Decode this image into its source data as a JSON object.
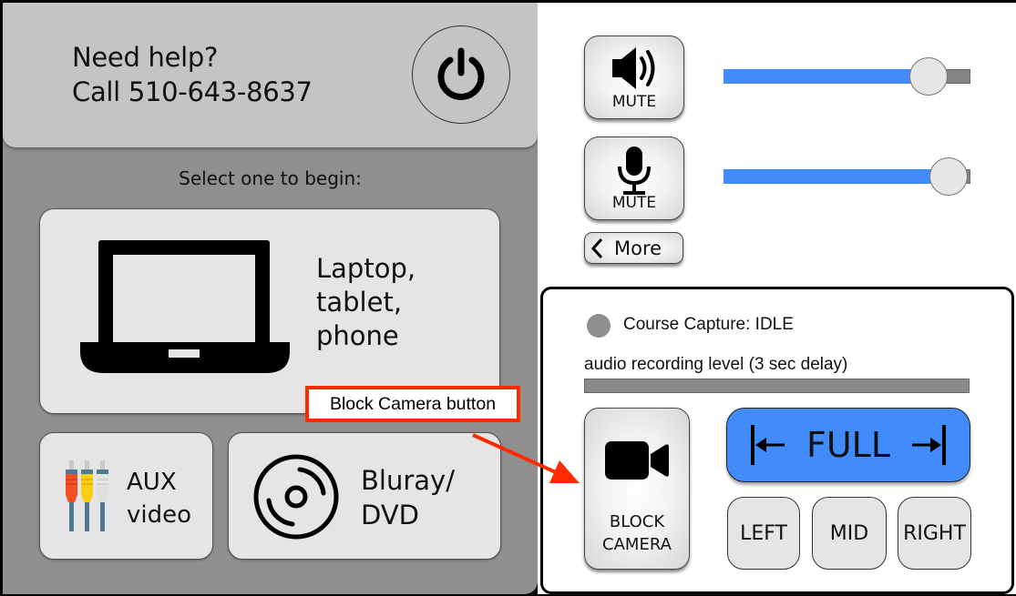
{
  "help": {
    "line1": "Need help?",
    "line2": "Call 510-643-8637",
    "power_icon": "power-icon"
  },
  "sources": {
    "prompt": "Select one to begin:",
    "items": [
      {
        "id": "laptop",
        "lines": [
          "Laptop,",
          "tablet,",
          "phone"
        ],
        "icon": "laptop-icon"
      },
      {
        "id": "aux",
        "lines": [
          "AUX",
          "video"
        ],
        "icon": "rca-cable-icon"
      },
      {
        "id": "bluray",
        "lines": [
          "Bluray/",
          "DVD"
        ],
        "icon": "disc-icon"
      }
    ]
  },
  "audio": {
    "volume": {
      "mute_label": "MUTE",
      "icon": "speaker-icon",
      "level": 0.83
    },
    "microphone": {
      "mute_label": "MUTE",
      "icon": "microphone-icon",
      "level": 0.91
    },
    "more_label": "More"
  },
  "capture": {
    "status_text": "Course Capture: IDLE",
    "status_color": "#8f8f8f",
    "level_label": "audio recording level (3 sec delay)",
    "level": 0,
    "block_camera": {
      "line1": "BLOCK",
      "line2": "CAMERA",
      "icon": "video-camera-icon"
    },
    "full_label": "FULL",
    "positions": [
      "LEFT",
      "MID",
      "RIGHT"
    ]
  },
  "annotation": {
    "label": "Block Camera button",
    "color": "#ff2a00"
  },
  "colors": {
    "accent_blue": "#428bfa",
    "panel_gray": "#8f8f8f",
    "header_gray": "#c4c4c4",
    "button_gray": "#e5e5e5"
  }
}
